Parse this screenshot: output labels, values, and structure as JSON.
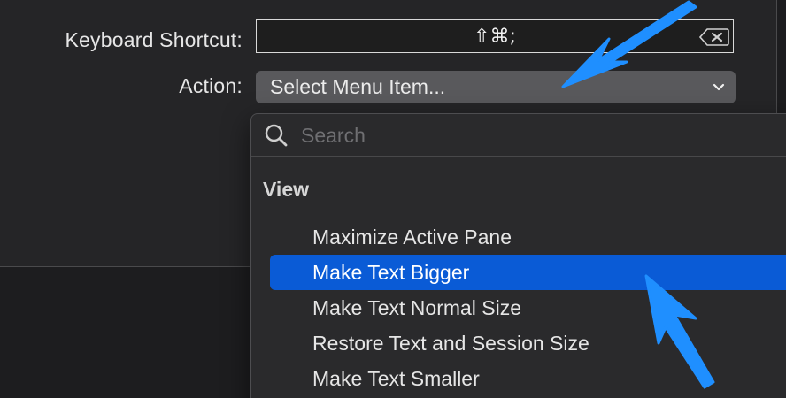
{
  "form": {
    "shortcut_label": "Keyboard Shortcut:",
    "shortcut_value": "⇧⌘;",
    "action_label": "Action:",
    "action_value": "Select Menu Item..."
  },
  "menu": {
    "search_placeholder": "Search",
    "section": "View",
    "items": [
      {
        "label": "Maximize Active Pane",
        "selected": false
      },
      {
        "label": "Make Text Bigger",
        "selected": true
      },
      {
        "label": "Make Text Normal Size",
        "selected": false
      },
      {
        "label": "Restore Text and Session Size",
        "selected": false
      },
      {
        "label": "Make Text Smaller",
        "selected": false
      }
    ]
  },
  "icons": {
    "search": "search-icon",
    "clear": "clear-icon",
    "chevron": "chevron-down-icon",
    "annotation_arrows": "arrow-icon"
  },
  "colors": {
    "selection": "#0a5bd6",
    "annotation_arrow": "#1f8fff"
  }
}
